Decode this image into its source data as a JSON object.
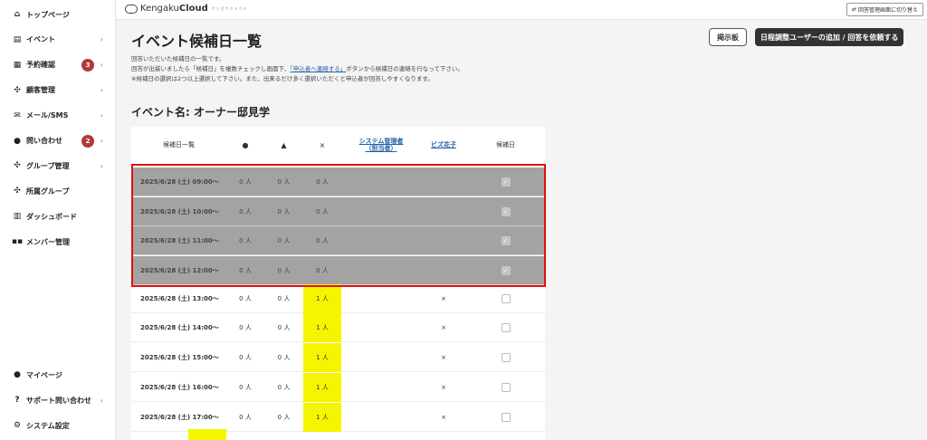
{
  "sidebar": {
    "items": [
      {
        "label": "トップページ",
        "icon": "home-icon",
        "glyph": "⌂",
        "chevron": ""
      },
      {
        "label": "イベント",
        "icon": "document-icon",
        "glyph": "▤",
        "chevron": "›"
      },
      {
        "label": "予約確認",
        "icon": "calendar-icon",
        "glyph": "▦",
        "chevron": "›",
        "badge": "3"
      },
      {
        "label": "顧客管理",
        "icon": "users-icon",
        "glyph": "✣",
        "chevron": "›"
      },
      {
        "label": "メール/SMS",
        "icon": "mail-icon",
        "glyph": "✉",
        "chevron": "›"
      },
      {
        "label": "問い合わせ",
        "icon": "chat-icon",
        "glyph": "●",
        "chevron": "›",
        "badge": "2"
      },
      {
        "label": "グループ管理",
        "icon": "group-icon",
        "glyph": "✣",
        "chevron": "›"
      },
      {
        "label": "所属グループ",
        "icon": "group-member-icon",
        "glyph": "✣",
        "chevron": ""
      },
      {
        "label": "ダッシュボード",
        "icon": "chart-icon",
        "glyph": "▥",
        "chevron": ""
      },
      {
        "label": "メンバー管理",
        "icon": "grid-icon",
        "glyph": "▪▪",
        "chevron": ""
      }
    ],
    "bottom_items": [
      {
        "label": "マイページ",
        "icon": "person-icon",
        "glyph": "●",
        "chevron": ""
      },
      {
        "label": "サポート問い合わせ",
        "icon": "help-icon",
        "glyph": "?",
        "chevron": "›"
      },
      {
        "label": "システム設定",
        "icon": "gear-icon",
        "glyph": "⚙",
        "chevron": ""
      }
    ]
  },
  "header": {
    "logo_light": "Kengaku",
    "logo_bold": "Cloud",
    "logo_sub": "ケンガククラウド",
    "switch_label": "回答管理画面に切り替え"
  },
  "page": {
    "title": "イベント候補日一覧",
    "board_button": "掲示板",
    "request_button": "日程調整ユーザーの追加 / 回答を依頼する",
    "desc_line1": "回答いただいた候補日の一覧です。",
    "desc_line2_before": "回答が出揃いましたら「候補日」を複数チェックし画面下、",
    "desc_line2_link": "「申込者へ連絡する」",
    "desc_line2_after": "ボタンから候補日の連絡を行なって下さい。",
    "desc_line3": "※候補日の選択は2つ以上選択して下さい。また、出来るだけ多く選択いただくと申込者が回答しやすくなります。",
    "event_label": "イベント名: オーナー邸見学"
  },
  "table": {
    "headers": {
      "date": "候補日一覧",
      "circle": "●",
      "triangle": "▲",
      "cross": "×",
      "user1_line1": "システム管理者",
      "user1_line2": "（担当者）",
      "user2": "ビズ花子",
      "candidate": "候補日"
    },
    "rows": [
      {
        "date": "2025/6/28 (土) 09:00〜",
        "c1": "0 人",
        "c2": "0 人",
        "c3": "0 人",
        "u1": "",
        "u2": "",
        "check": "✓",
        "selected": true
      },
      {
        "date": "2025/6/28 (土) 10:00〜",
        "c1": "0 人",
        "c2": "0 人",
        "c3": "0 人",
        "u1": "",
        "u2": "",
        "check": "✓",
        "selected": true
      },
      {
        "date": "2025/6/28 (土) 11:00〜",
        "c1": "0 人",
        "c2": "0 人",
        "c3": "0 人",
        "u1": "",
        "u2": "",
        "check": "✓",
        "selected": true
      },
      {
        "date": "2025/6/28 (土) 12:00〜",
        "c1": "0 人",
        "c2": "0 人",
        "c3": "0 人",
        "u1": "",
        "u2": "",
        "check": "✓",
        "selected": true
      },
      {
        "date": "2025/6/28 (土) 13:00〜",
        "c1": "0 人",
        "c2": "0 人",
        "c3": "1 人",
        "u1": "",
        "u2": "×",
        "check": "",
        "selected": false
      },
      {
        "date": "2025/6/28 (土) 14:00〜",
        "c1": "0 人",
        "c2": "0 人",
        "c3": "1 人",
        "u1": "",
        "u2": "×",
        "check": "",
        "selected": false
      },
      {
        "date": "2025/6/28 (土) 15:00〜",
        "c1": "0 人",
        "c2": "0 人",
        "c3": "1 人",
        "u1": "",
        "u2": "×",
        "check": "",
        "selected": false
      },
      {
        "date": "2025/6/28 (土) 16:00〜",
        "c1": "0 人",
        "c2": "0 人",
        "c3": "1 人",
        "u1": "",
        "u2": "×",
        "check": "",
        "selected": false
      },
      {
        "date": "2025/6/28 (土) 17:00〜",
        "c1": "0 人",
        "c2": "0 人",
        "c3": "1 人",
        "u1": "",
        "u2": "×",
        "check": "",
        "selected": false
      }
    ]
  },
  "colors": {
    "selected_row": "#a3a3a3",
    "highlight_border": "#e31010",
    "cross_count_highlight": "#f5f500",
    "badge": "#b03a3a",
    "link": "#1f5fa8"
  }
}
